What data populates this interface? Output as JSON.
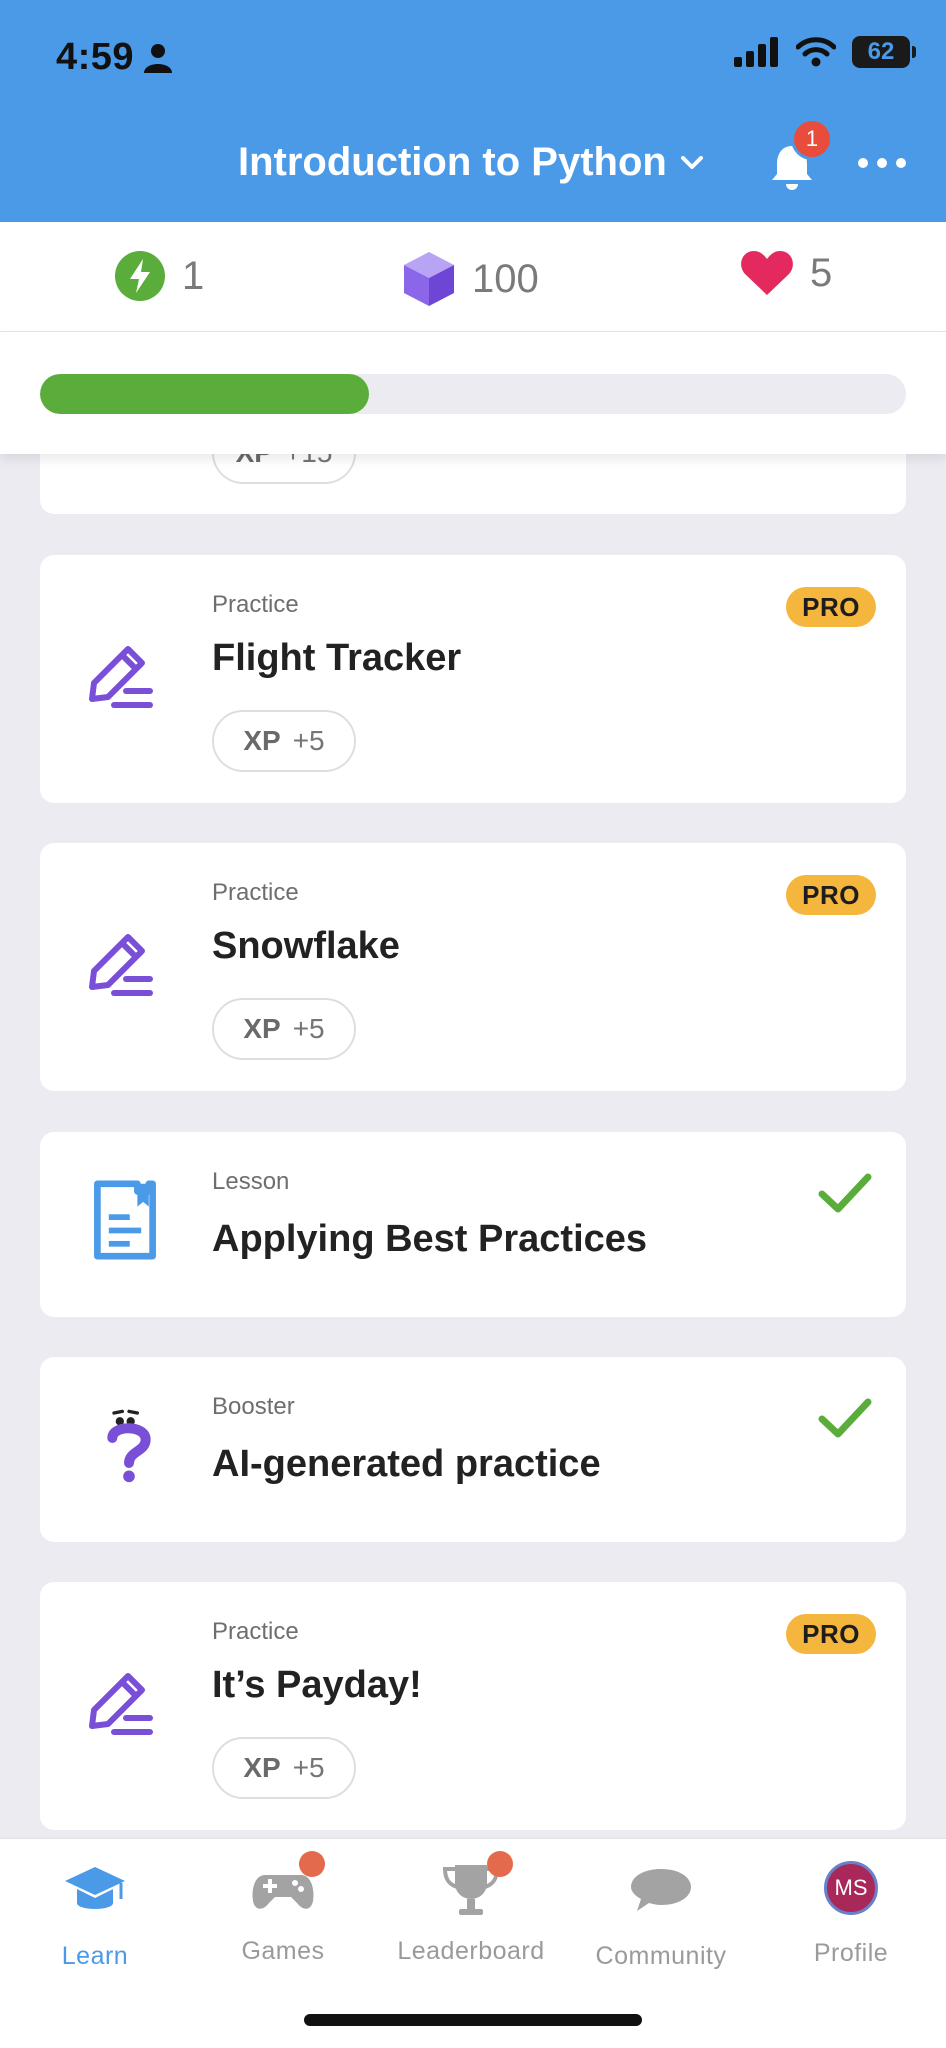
{
  "status_bar": {
    "time": "4:59",
    "battery": "62"
  },
  "header": {
    "title": "Introduction to Python",
    "notification_count": "1"
  },
  "stats": {
    "streak": "1",
    "gems": "100",
    "hearts": "5"
  },
  "progress": {
    "fraction": 0.38
  },
  "partial_card": {
    "xp_label": "XP",
    "xp_value": "+15"
  },
  "cards": [
    {
      "type": "Practice",
      "title": "Flight Tracker",
      "xp_label": "XP",
      "xp_value": "+5",
      "badge": "PRO"
    },
    {
      "type": "Practice",
      "title": "Snowflake",
      "xp_label": "XP",
      "xp_value": "+5",
      "badge": "PRO"
    },
    {
      "type": "Lesson",
      "title": "Applying Best Practices",
      "status": "completed"
    },
    {
      "type": "Booster",
      "title": "AI-generated practice",
      "status": "completed"
    },
    {
      "type": "Practice",
      "title": "It’s Payday!",
      "xp_label": "XP",
      "xp_value": "+5",
      "badge": "PRO"
    }
  ],
  "tabbar": {
    "learn": "Learn",
    "games": "Games",
    "leaderboard": "Leaderboard",
    "community": "Community",
    "profile": "Profile",
    "profile_initials": "MS"
  },
  "colors": {
    "header": "#4a9ae8",
    "accent_green": "#5aad3a",
    "pro": "#f4b63d",
    "icon_purple": "#7a4fd8",
    "lesson_blue": "#4a9ae8"
  }
}
